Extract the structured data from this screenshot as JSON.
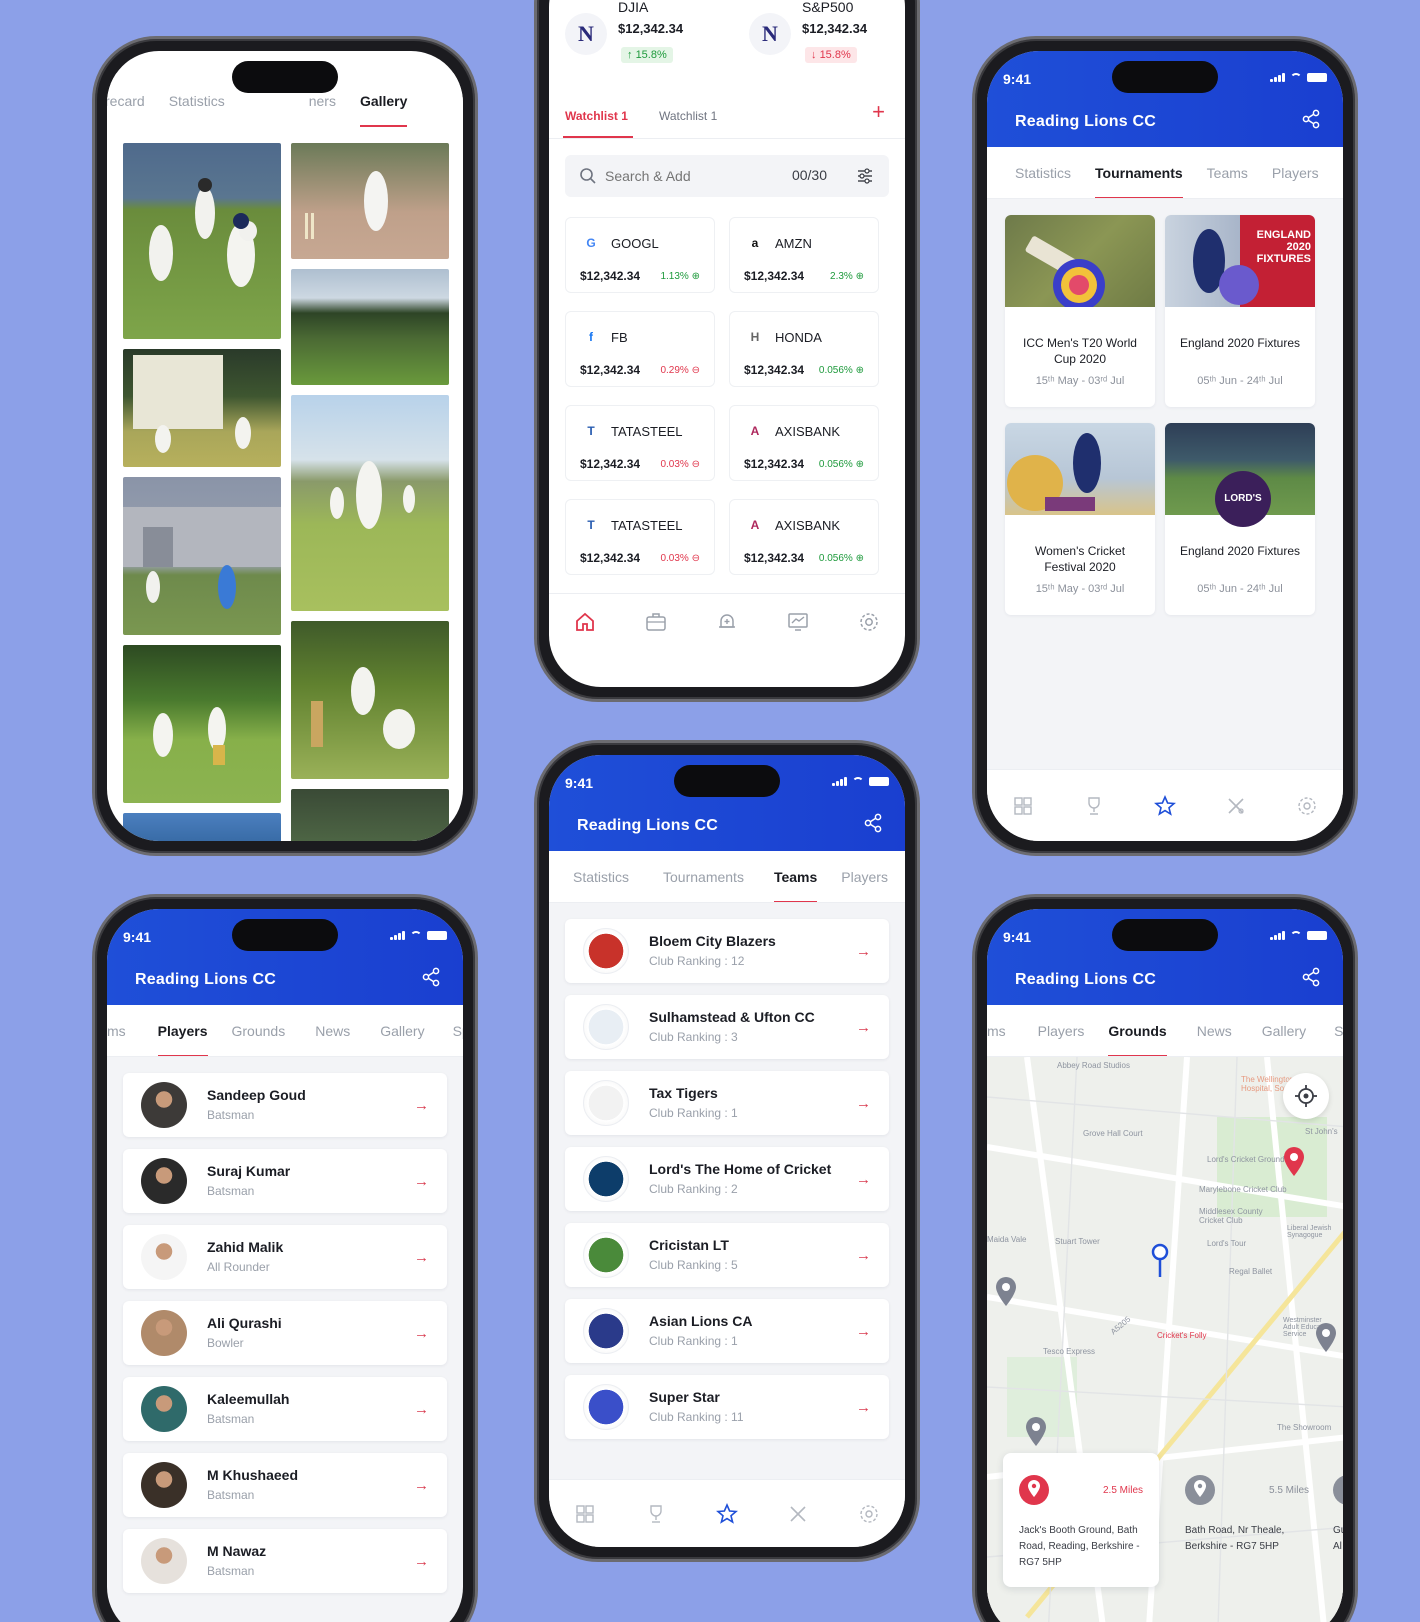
{
  "screens": {
    "gallery": {
      "tabs": [
        "recard",
        "Statistics",
        "ners",
        "Gallery"
      ],
      "active_tab": "Gallery"
    },
    "stocks": {
      "indices": [
        {
          "name": "DJIA",
          "value": "$12,342.34",
          "change": "15.8%",
          "direction": "up"
        },
        {
          "name": "S&P500",
          "value": "$12,342.34",
          "change": "15.8%",
          "direction": "down"
        }
      ],
      "watchlists": [
        "Watchlist 1",
        "Watchlist 1"
      ],
      "add_label": "+",
      "search": {
        "placeholder": "Search & Add",
        "count": "00/30"
      },
      "stocks": [
        {
          "ticker": "GOOGL",
          "price": "$12,342.34",
          "change": "1.13%",
          "direction": "up",
          "logo": "G",
          "color": "#4285f4"
        },
        {
          "ticker": "AMZN",
          "price": "$12,342.34",
          "change": "2.3%",
          "direction": "up",
          "logo": "a",
          "color": "#111111"
        },
        {
          "ticker": "FB",
          "price": "$12,342.34",
          "change": "0.29%",
          "direction": "down",
          "logo": "f",
          "color": "#1877f2"
        },
        {
          "ticker": "HONDA",
          "price": "$12,342.34",
          "change": "0.056%",
          "direction": "up",
          "logo": "H",
          "color": "#666666"
        },
        {
          "ticker": "TATASTEEL",
          "price": "$12,342.34",
          "change": "0.03%",
          "direction": "down",
          "logo": "T",
          "color": "#2a5db0"
        },
        {
          "ticker": "AXISBANK",
          "price": "$12,342.34",
          "change": "0.056%",
          "direction": "up",
          "logo": "A",
          "color": "#ae285d"
        },
        {
          "ticker": "TATASTEEL",
          "price": "$12,342.34",
          "change": "0.03%",
          "direction": "down",
          "logo": "T",
          "color": "#2a5db0"
        },
        {
          "ticker": "AXISBANK",
          "price": "$12,342.34",
          "change": "0.056%",
          "direction": "up",
          "logo": "A",
          "color": "#ae285d"
        }
      ]
    },
    "tournaments": {
      "time": "9:41",
      "title": "Reading Lions CC",
      "tabs": [
        "Statistics",
        "Tournaments",
        "Teams",
        "Players"
      ],
      "active_tab": "Tournaments",
      "items": [
        {
          "name": "ICC Men's T20 World Cup 2020",
          "dates": "15ᵗʰ May - 03ʳᵈ Jul"
        },
        {
          "name": "England 2020 Fixtures",
          "dates": "05ᵗʰ Jun - 24ᵗʰ Jul",
          "banner": "ENGLAND 2020 FIXTURES"
        },
        {
          "name": "Women's Cricket Festival 2020",
          "dates": "15ᵗʰ May - 03ʳᵈ Jul"
        },
        {
          "name": "England 2020 Fixtures",
          "dates": "05ᵗʰ Jun - 24ᵗʰ Jul",
          "badge": "LORD'S"
        }
      ]
    },
    "teams": {
      "time": "9:41",
      "title": "Reading Lions CC",
      "tabs": [
        "Statistics",
        "Tournaments",
        "Teams",
        "Players"
      ],
      "active_tab": "Teams",
      "items": [
        {
          "name": "Bloem City Blazers",
          "ranking": "Club Ranking : 12"
        },
        {
          "name": "Sulhamstead & Ufton CC",
          "ranking": "Club Ranking : 3"
        },
        {
          "name": "Tax Tigers",
          "ranking": "Club Ranking : 1"
        },
        {
          "name": "Lord's The Home of Cricket",
          "ranking": "Club Ranking : 2"
        },
        {
          "name": "Cricistan LT",
          "ranking": "Club Ranking : 5"
        },
        {
          "name": "Asian Lions CA",
          "ranking": "Club Ranking : 1"
        },
        {
          "name": "Super Star",
          "ranking": "Club Ranking : 11"
        }
      ]
    },
    "players": {
      "time": "9:41",
      "title": "Reading Lions CC",
      "tabs": [
        "ms",
        "Players",
        "Grounds",
        "News",
        "Gallery",
        "Sp"
      ],
      "active_tab": "Players",
      "items": [
        {
          "name": "Sandeep Goud",
          "role": "Batsman"
        },
        {
          "name": "Suraj Kumar",
          "role": "Batsman"
        },
        {
          "name": "Zahid Malik",
          "role": "All Rounder"
        },
        {
          "name": "Ali Qurashi",
          "role": "Bowler"
        },
        {
          "name": "Kaleemullah",
          "role": "Batsman"
        },
        {
          "name": "M Khushaeed",
          "role": "Batsman"
        },
        {
          "name": "M Nawaz",
          "role": "Batsman"
        }
      ]
    },
    "grounds": {
      "time": "9:41",
      "title": "Reading Lions CC",
      "tabs": [
        "ms",
        "Players",
        "Grounds",
        "News",
        "Gallery",
        "Sp"
      ],
      "active_tab": "Grounds",
      "map_labels": [
        "Abbey Road Studios",
        "Grove Hall Court",
        "Lord's Cricket Ground",
        "Marylebone Cricket Club",
        "Middlesex County Cricket Club",
        "Stuart Tower",
        "Lord's Tour",
        "Regal Ballet",
        "Cricket's Folly",
        "Tesco Express",
        "The Showroom",
        "Westminster Adult Education Service",
        "The Wellington Hospital, South",
        "St John's",
        "Liberal Jewish Synagogue",
        "A5205",
        "Maida Vale"
      ],
      "cards": [
        {
          "distance": "2.5 Miles",
          "address": "Jack's Booth Ground, Bath Road, Reading, Berkshire - RG7 5HP"
        },
        {
          "distance": "5.5 Miles",
          "address": "Bath Road, Nr Theale, Berkshire - RG7 5HP"
        },
        {
          "distance": "",
          "address": "Gu Al -"
        }
      ]
    }
  },
  "colors": {
    "background": "#8ca0e8",
    "brand_blue": "#1f4fd8",
    "accent_red": "#e0364c",
    "positive_green": "#1e9a3c"
  }
}
